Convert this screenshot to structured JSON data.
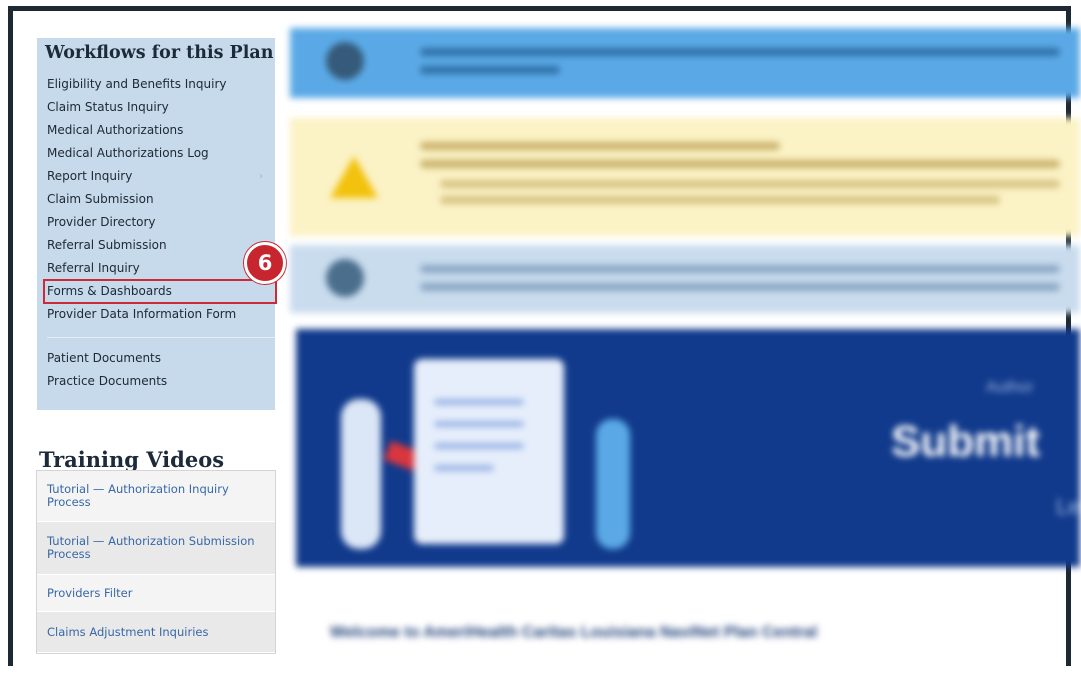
{
  "sidebar": {
    "workflows_title": "Workflows for this Plan",
    "items": [
      {
        "label": "Eligibility and Benefits Inquiry"
      },
      {
        "label": "Claim Status Inquiry"
      },
      {
        "label": "Medical Authorizations"
      },
      {
        "label": "Medical Authorizations Log"
      },
      {
        "label": "Report Inquiry"
      },
      {
        "label": "Claim Submission"
      },
      {
        "label": "Provider Directory"
      },
      {
        "label": "Referral Submission"
      },
      {
        "label": "Referral Inquiry"
      },
      {
        "label": "Forms & Dashboards"
      },
      {
        "label": "Provider Data Information Form"
      }
    ],
    "documents": [
      {
        "label": "Patient Documents"
      },
      {
        "label": "Practice Documents"
      }
    ],
    "step_badge": "6"
  },
  "training": {
    "title": "Training Videos",
    "items": [
      {
        "label": "Tutorial — Authorization Inquiry Process"
      },
      {
        "label": "Tutorial — Authorization Submission Process"
      },
      {
        "label": "Providers Filter"
      },
      {
        "label": "Claims Adjustment Inquiries"
      }
    ]
  },
  "main": {
    "hero_heading": "Submit",
    "hero_small_top": "Author",
    "hero_small_bottom": "Le",
    "welcome_text": "Welcome to AmeriHealth Caritas Louisiana NaviNet Plan Central"
  },
  "colors": {
    "highlight": "#cc2a36",
    "sidebar_bg": "#c6daec",
    "link": "#3767a8",
    "hero_bg": "#113a8c"
  }
}
